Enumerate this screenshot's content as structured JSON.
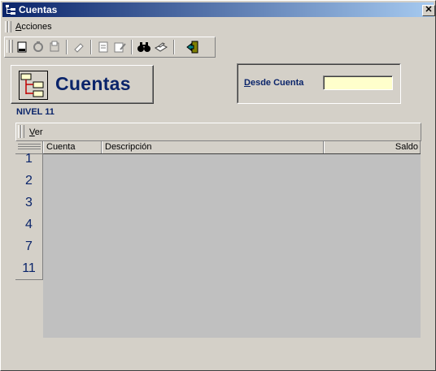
{
  "window": {
    "title": "Cuentas",
    "close_glyph": "✕"
  },
  "menu": {
    "acciones_label": "Acciones"
  },
  "toolbar": {
    "buttons": [
      "new-document-icon",
      "refresh-icon",
      "print-preview-icon",
      "eraser-icon",
      "notes-icon",
      "edit-icon",
      "binoculars-icon",
      "printer-icon",
      "exit-door-icon"
    ]
  },
  "header": {
    "title": "Cuentas",
    "icon": "tree-hierarchy-icon"
  },
  "filter": {
    "label": "Desde Cuenta",
    "value": ""
  },
  "level_label": "NIVEL 11",
  "view_bar": {
    "label": "Ver"
  },
  "grid": {
    "columns": [
      "Cuenta",
      "Descripción",
      "Saldo"
    ],
    "row_levels": [
      "1",
      "2",
      "3",
      "4",
      "7",
      "11"
    ]
  },
  "colors": {
    "accent": "#0a246a",
    "input_bg": "#ffffcc",
    "grid_bg": "#c0c0c0",
    "face": "#d4d0c8"
  }
}
